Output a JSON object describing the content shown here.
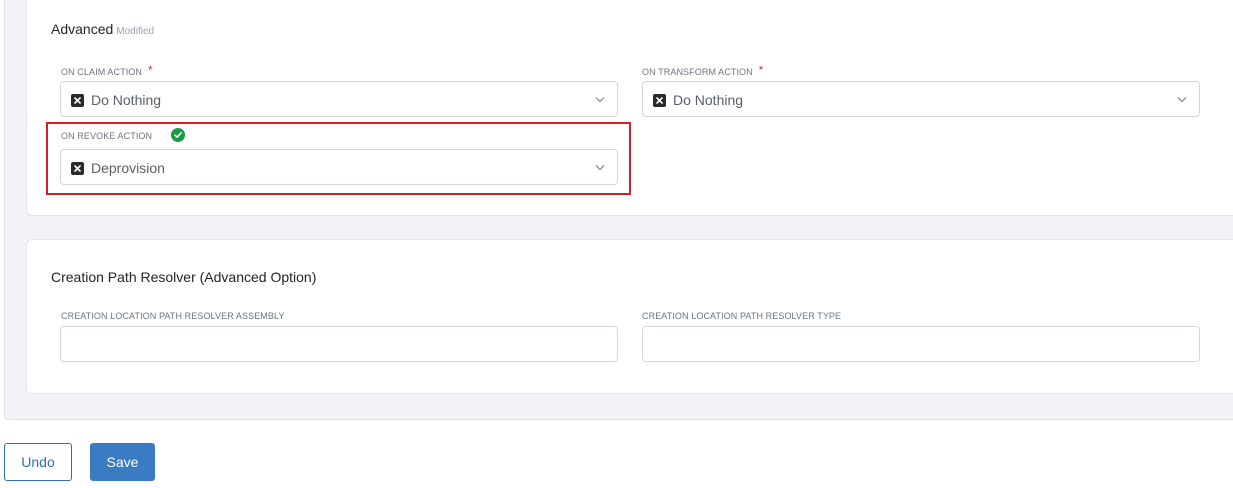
{
  "advanced": {
    "title": "Advanced",
    "badge": "Modified",
    "on_claim": {
      "label": "ON CLAIM ACTION",
      "required": "*",
      "value": "Do Nothing"
    },
    "on_transform": {
      "label": "ON TRANSFORM ACTION",
      "required": "*",
      "value": "Do Nothing"
    },
    "on_revoke": {
      "label": "ON REVOKE ACTION",
      "value": "Deprovision"
    }
  },
  "resolver": {
    "title": "Creation Path Resolver (Advanced Option)",
    "assembly_label": "CREATION LOCATION PATH RESOLVER ASSEMBLY",
    "assembly_value": "",
    "type_label": "CREATION LOCATION PATH RESOLVER TYPE",
    "type_value": ""
  },
  "actions": {
    "undo": "Undo",
    "save": "Save"
  },
  "colors": {
    "accent": "#3a7cc3",
    "required": "#e0245e",
    "valid": "#1e9b48",
    "highlight": "#d3202a"
  },
  "icons": {
    "clear": "close-icon",
    "dropdown": "chevron-down-icon",
    "valid": "check-circle-icon"
  }
}
